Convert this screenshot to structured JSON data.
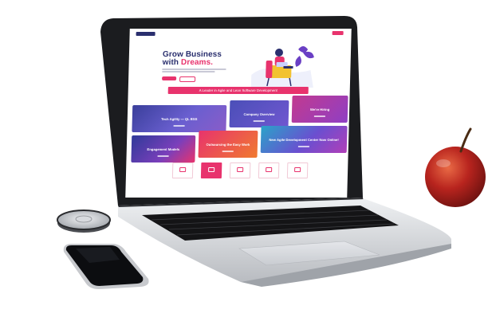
{
  "screen": {
    "nav": {
      "items": [
        "",
        "",
        "",
        "",
        "",
        ""
      ],
      "cta": ""
    },
    "hero": {
      "title_line1": "Grow Business",
      "title_line2_prefix": "with ",
      "title_line2_highlight": "Dreams."
    },
    "banner": "A Leader in Agile and Lean Software Development",
    "cards": [
      {
        "label": "Tech Agility — QL BSS"
      },
      {
        "label": "Company Overview"
      },
      {
        "label": "We're Hiring"
      },
      {
        "label": "Engagement Models"
      },
      {
        "label": "Outsourcing the Easy Work"
      },
      {
        "label": "New Agile Development Center Now Online!"
      }
    ],
    "services": [
      {
        "label": ""
      },
      {
        "label": ""
      },
      {
        "label": ""
      },
      {
        "label": ""
      },
      {
        "label": ""
      }
    ]
  },
  "colors": {
    "accent": "#e8336d",
    "brand_navy": "#2a2f6e",
    "apple_red": "#b8241e",
    "laptop_silver": "#d9dbdf"
  },
  "icons": [
    "laptop",
    "smartphone",
    "fidget-spinner",
    "apple"
  ]
}
